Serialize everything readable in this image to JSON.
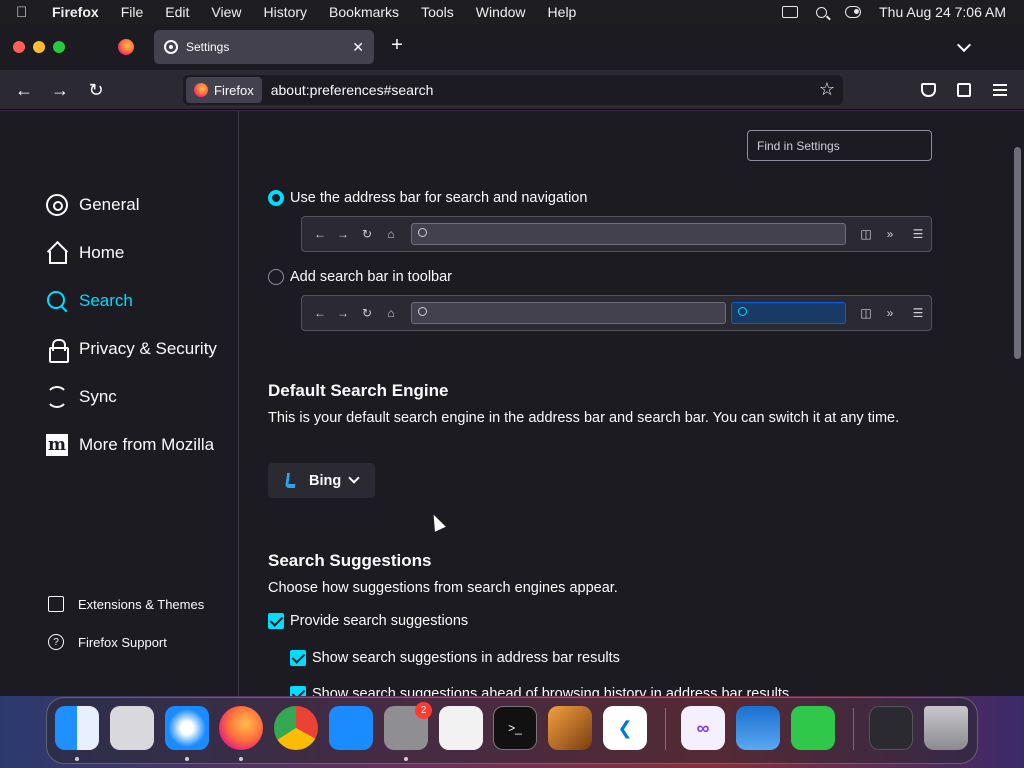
{
  "menubar": {
    "app_name": "Firefox",
    "items": [
      "File",
      "Edit",
      "View",
      "History",
      "Bookmarks",
      "Tools",
      "Window",
      "Help"
    ],
    "clock": "Thu Aug 24  7:06 AM"
  },
  "tabs": {
    "active_title": "Settings",
    "close_glyph": "✕",
    "new_tab_glyph": "+"
  },
  "urlbar": {
    "identity_label": "Firefox",
    "url": "about:preferences#search"
  },
  "sidebar": {
    "categories": [
      {
        "label": "General",
        "icon": "gear-icon"
      },
      {
        "label": "Home",
        "icon": "home-icon"
      },
      {
        "label": "Search",
        "icon": "search-icon"
      },
      {
        "label": "Privacy & Security",
        "icon": "lock-icon"
      },
      {
        "label": "Sync",
        "icon": "sync-icon"
      },
      {
        "label": "More from Mozilla",
        "icon": "mozilla-icon"
      }
    ],
    "selected": "Search",
    "footer": [
      {
        "label": "Extensions & Themes",
        "icon": "puzzle-icon"
      },
      {
        "label": "Firefox Support",
        "icon": "help-icon"
      }
    ]
  },
  "find": {
    "placeholder": "Find in Settings"
  },
  "search_bar_options": {
    "address_bar": {
      "label": "Use the address bar for search and navigation",
      "checked": true
    },
    "toolbar": {
      "label": "Add search bar in toolbar",
      "checked": false
    }
  },
  "default_engine": {
    "heading": "Default Search Engine",
    "description": "This is your default search engine in the address bar and search bar. You can switch it at any time.",
    "selected": "Bing"
  },
  "suggestions": {
    "heading": "Search Suggestions",
    "description": "Choose how suggestions from search engines appear.",
    "provide": {
      "label": "Provide search suggestions",
      "checked": true
    },
    "in_address_bar": {
      "label": "Show search suggestions in address bar results",
      "checked": true
    },
    "ahead_of_history": {
      "label": "Show search suggestions ahead of browsing history in address bar results",
      "checked": true
    }
  },
  "dock": {
    "apps": [
      "finder-icon",
      "launchpad-icon",
      "safari-icon",
      "firefox-icon",
      "chrome-icon",
      "app-store-icon",
      "system-settings-icon",
      "textedit-icon",
      "terminal-icon",
      "garageband-icon",
      "vscode-icon",
      "visual-studio-icon",
      "weather-icon",
      "facetime-icon",
      "screenshot-icon",
      "trash-icon"
    ],
    "settings_badge": "2"
  },
  "colors": {
    "accent": "#00ddff",
    "background": "#1c1b22",
    "toolbar": "#2b2a33"
  }
}
